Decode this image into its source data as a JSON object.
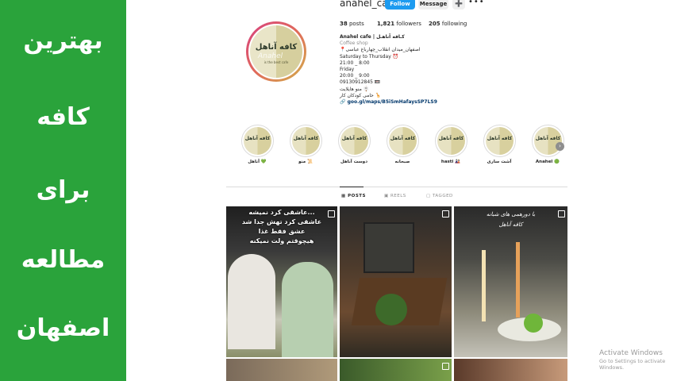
{
  "left_panel": {
    "words": [
      "بهترین",
      "کافه",
      "برای",
      "مطالعه",
      "اصفهان"
    ],
    "color": "#2aa33b"
  },
  "profile": {
    "username": "anahel_cafe",
    "follow_label": "Follow",
    "message_label": "Message",
    "adduser_icon": "add-user-icon",
    "more_label": "•••",
    "stats": {
      "posts_count": "38",
      "posts_label": "posts",
      "followers_count": "1,821",
      "followers_label": "followers",
      "following_count": "205",
      "following_label": "following"
    },
    "avatar_logo": "کافه آناهل",
    "avatar_script": "Anahel",
    "avatar_sub": "is the best cafe"
  },
  "bio": {
    "name": "Anahel cafe | کـافه آناهـل",
    "category": "Coffee shop",
    "lines": [
      "📍اصفهان_میدان انقلاب_چهارباغ عباسی",
      "Saturday to Thursday ⏰",
      "21:00 _ 8:00",
      "Friday",
      "20:00 _ 9:00",
      "09130912845 📼",
      "منو هایلایت 🪧",
      "حامی کودکان کار 🦒"
    ],
    "link": "goo.gl/maps/B5iSmHafaysSP7LS9"
  },
  "highlights": [
    {
      "label": "آناهل 💚",
      "thumb": "کافه آناهل"
    },
    {
      "label": "منو 📜",
      "thumb": "کافه آناهل"
    },
    {
      "label": "دوست آناهل",
      "thumb": "کافه آناهل"
    },
    {
      "label": "صبحانه",
      "thumb": "کافه آناهل"
    },
    {
      "label": "hasti 🎎",
      "thumb": "کافه آناهل"
    },
    {
      "label": "آشت ساری",
      "thumb": "کافه آناهل"
    },
    {
      "label": "Anahel 🟢",
      "thumb": "کافه آناهل"
    }
  ],
  "highlight_next": "›",
  "tabs": [
    {
      "label": "POSTS",
      "icon": "grid-icon"
    },
    {
      "label": "REELS",
      "icon": "reels-icon"
    },
    {
      "label": "TAGGED",
      "icon": "tagged-icon"
    }
  ],
  "posts": {
    "post1_caption": [
      "...عاشقی کرد نمیشه",
      "عاشقی کرد تهش جدا شد",
      "عشق فقط غذا",
      "هیچوقتم ولت نمیکنه"
    ],
    "post3_caption": [
      "با دورهمی های شبانه",
      "کافه آناهل"
    ]
  },
  "windows_notice": {
    "title": "Activate Windows",
    "subtitle": "Go to Settings to activate Windows."
  }
}
